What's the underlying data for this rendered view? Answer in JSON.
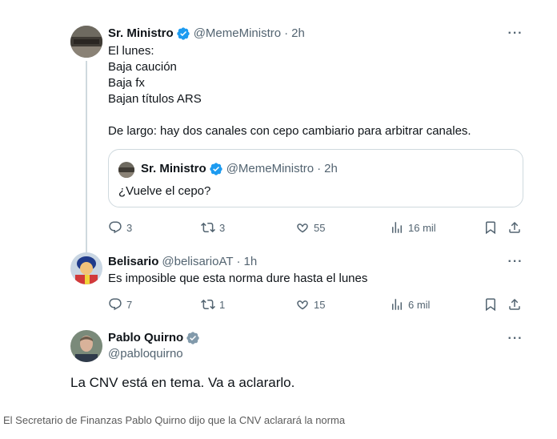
{
  "tweets": [
    {
      "name": "Sr. Ministro",
      "handle": "@MemeMinistro",
      "sep": "·",
      "time": "2h",
      "text": "El lunes:\nBaja caución\nBaja fx\nBajan títulos ARS\n\nDe largo: hay dos canales con cepo cambiario para arbitrar canales.",
      "quote": {
        "name": "Sr. Ministro",
        "handle": "@MemeMinistro",
        "sep": "·",
        "time": "2h",
        "text": "¿Vuelve el cepo?"
      },
      "actions": {
        "replies": "3",
        "retweets": "3",
        "likes": "55",
        "views": "16 mil"
      }
    },
    {
      "name": "Belisario",
      "handle": "@belisarioAT",
      "sep": "·",
      "time": "1h",
      "text": "Es imposible que esta norma dure hasta el lunes",
      "actions": {
        "replies": "7",
        "retweets": "1",
        "likes": "15",
        "views": "6 mil"
      }
    },
    {
      "name": "Pablo Quirno",
      "handle": "@pabloquirno",
      "text": "La CNV está en tema. Va a aclararlo."
    }
  ],
  "caption": "El Secretario de Finanzas Pablo Quirno dijo que la CNV aclarará la norma",
  "colors": {
    "verified_blue": "#1d9bf0",
    "verified_gray": "#829aab",
    "secondary_text": "#536471",
    "border": "#cfd9de"
  },
  "icons": [
    "verified-badge-icon",
    "more-icon",
    "reply-icon",
    "retweet-icon",
    "like-icon",
    "views-icon",
    "bookmark-icon",
    "share-icon"
  ]
}
